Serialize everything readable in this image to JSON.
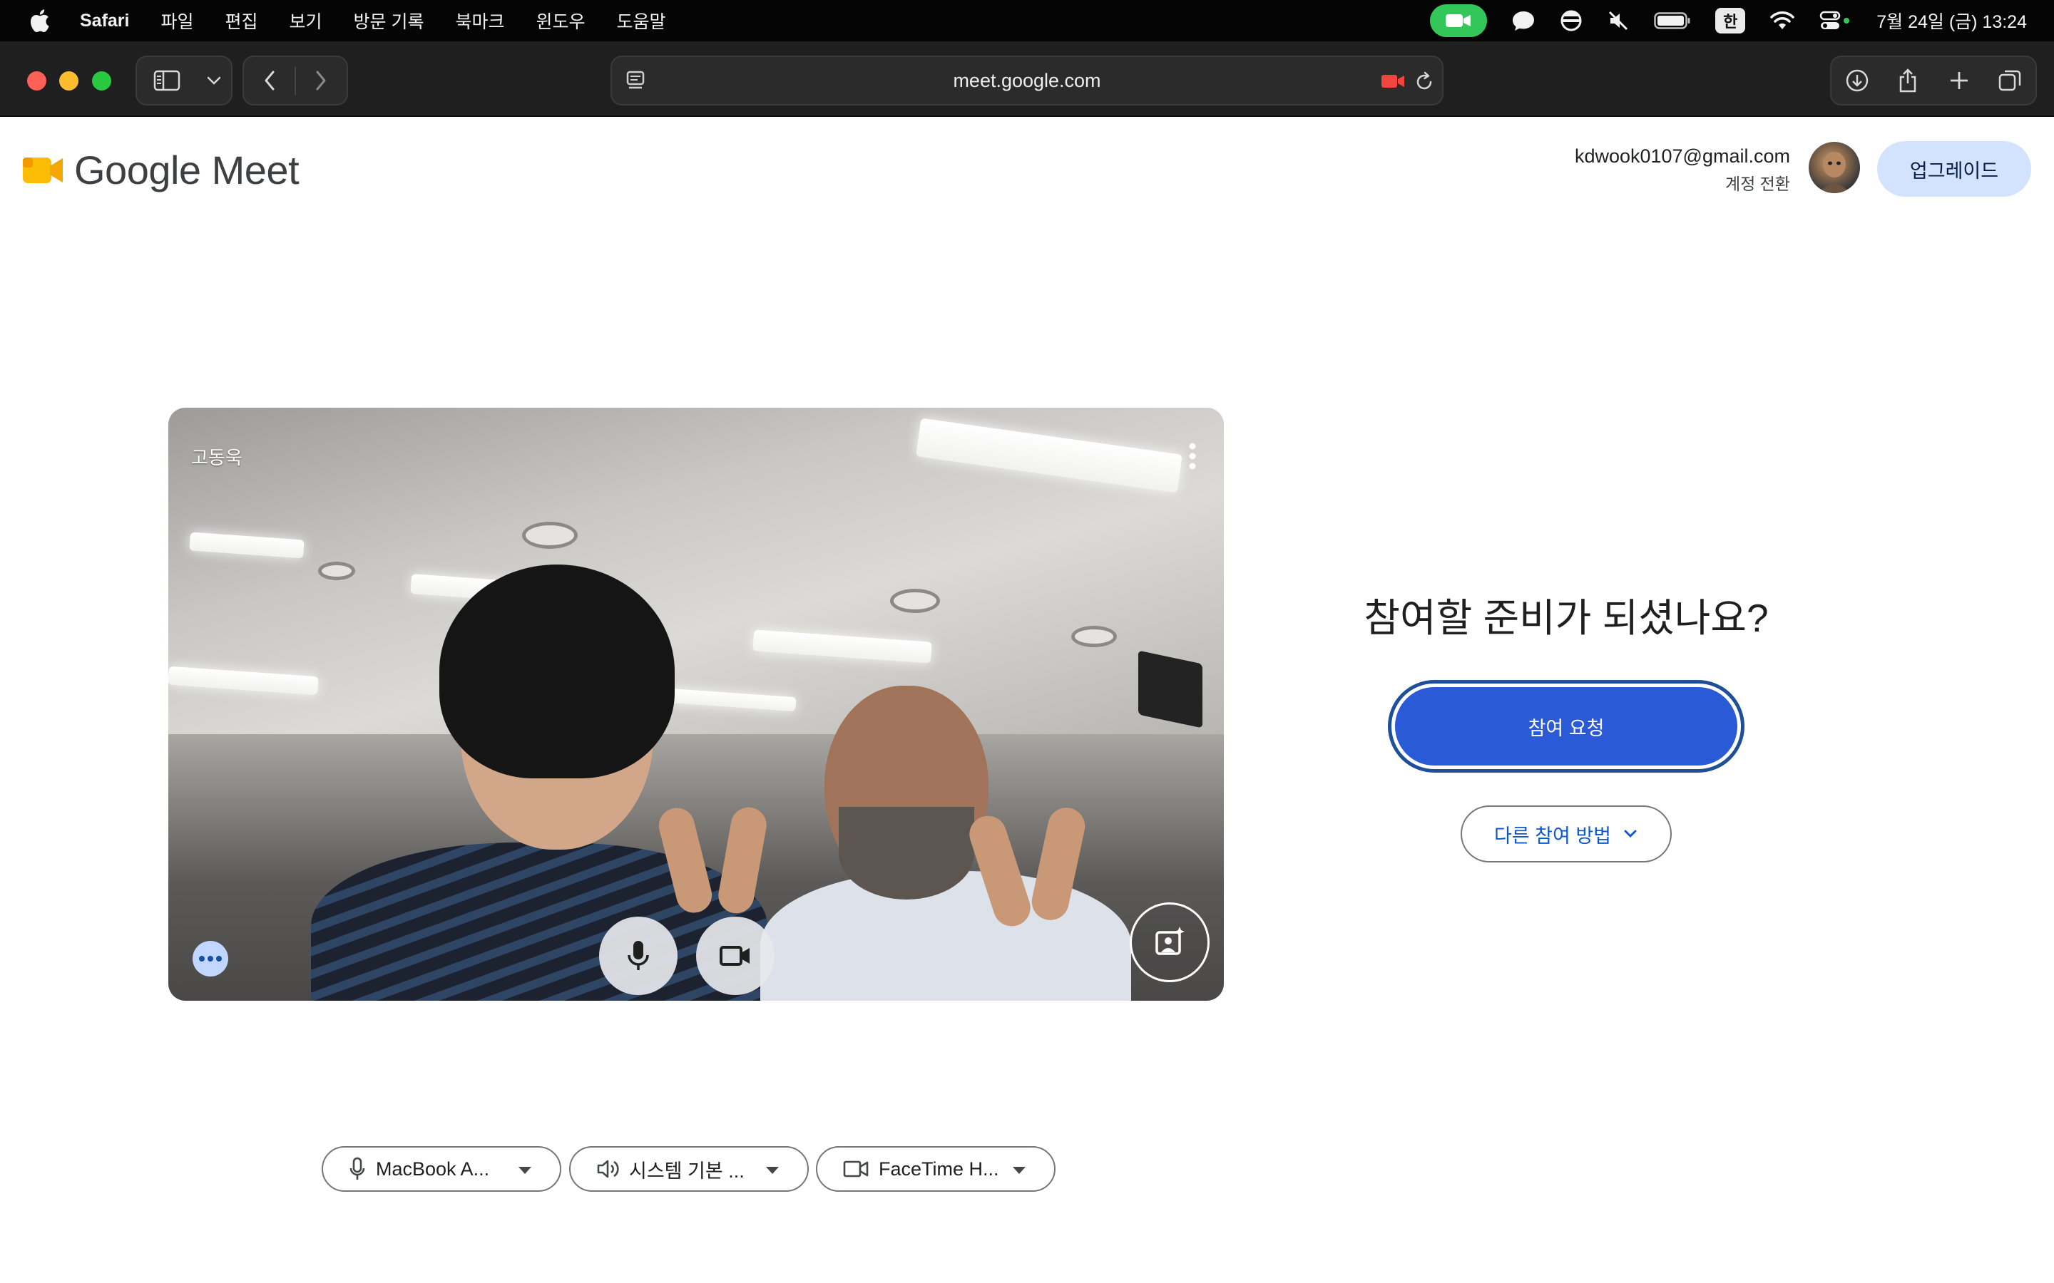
{
  "menubar": {
    "app_name": "Safari",
    "items": [
      "파일",
      "편집",
      "보기",
      "방문 기록",
      "북마크",
      "윈도우",
      "도움말"
    ],
    "input_method": "한",
    "clock": "7월 24일 (금) 13:24",
    "colors": {
      "camera_indicator": "#33c759"
    }
  },
  "browser": {
    "url": "meet.google.com",
    "icons": [
      "sidebar-icon",
      "chevron-down-icon",
      "back-icon",
      "forward-icon",
      "reader-icon",
      "recording-camera-icon",
      "reload-icon",
      "download-icon",
      "share-icon",
      "new-tab-icon",
      "tabs-overview-icon"
    ]
  },
  "header": {
    "brand": "Google Meet",
    "account_email": "kdwook0107@gmail.com",
    "account_switch": "계정 전환",
    "upgrade_label": "업그레이드"
  },
  "preview": {
    "self_name": "고동욱"
  },
  "devices": {
    "microphone": "MacBook A...",
    "speaker": "시스템 기본 ...",
    "camera": "FaceTime H..."
  },
  "join": {
    "title": "참여할 준비가 되셨나요?",
    "request_label": "참여 요청",
    "other_ways_label": "다른 참여 방법",
    "colors": {
      "primary": "#2b5ad6",
      "link": "#0b57d0"
    }
  }
}
